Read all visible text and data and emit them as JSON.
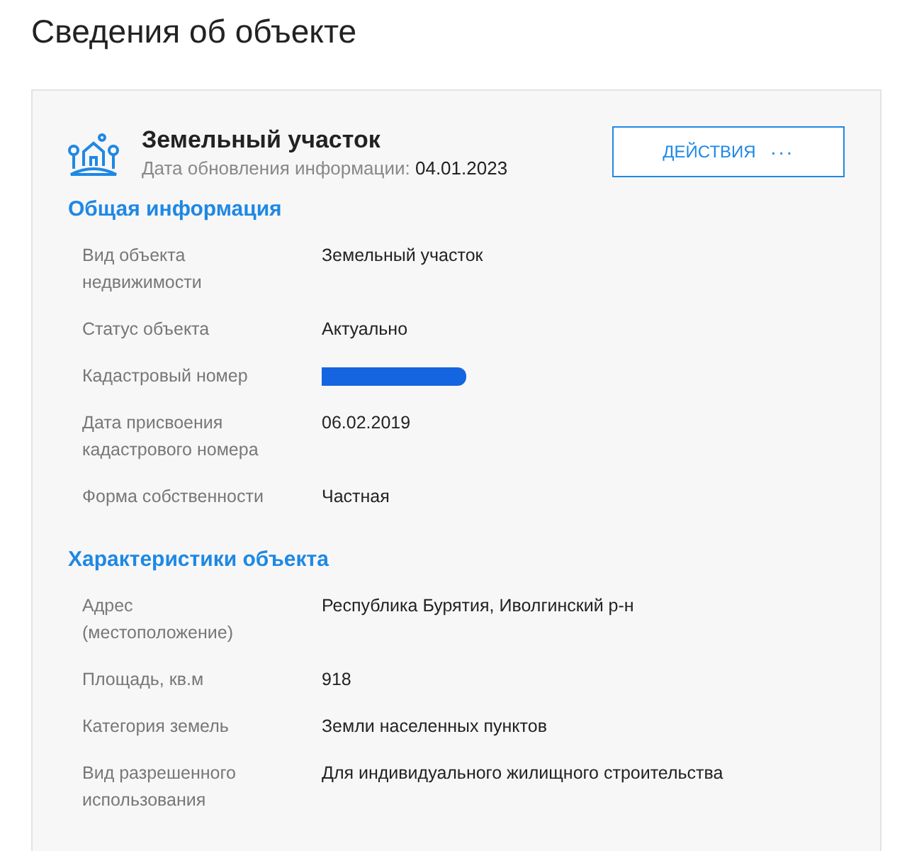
{
  "page_title": "Сведения об объекте",
  "object": {
    "title": "Земельный участок",
    "update_label": "Дата обновления информации:",
    "update_date": "04.01.2023",
    "actions_button": {
      "label": "ДЕЙСТВИЯ",
      "icon_text": "···"
    }
  },
  "sections": [
    {
      "title": "Общая информация",
      "rows": [
        {
          "label": "Вид объекта недвижимости",
          "value": "Земельный участок",
          "redacted": false
        },
        {
          "label": "Статус объекта",
          "value": "Актуально",
          "redacted": false
        },
        {
          "label": "Кадастровый номер",
          "redacted": true
        },
        {
          "label": "Дата присвоения кадастрового номера",
          "value": "06.02.2019",
          "redacted": false
        },
        {
          "label": "Форма собственности",
          "value": "Частная",
          "redacted": false
        }
      ]
    },
    {
      "title": "Характеристики объекта",
      "rows": [
        {
          "label": "Адрес (местоположение)",
          "value": "Республика Бурятия, Иволгинский р-н",
          "redacted": false
        },
        {
          "label": "Площадь, кв.м",
          "value": "918",
          "redacted": false
        },
        {
          "label": "Категория земель",
          "value": "Земли населенных пунктов",
          "redacted": false
        },
        {
          "label": "Вид разрешенного использования",
          "value": "Для индивидуального жилищного строительства",
          "redacted": false
        }
      ]
    }
  ]
}
